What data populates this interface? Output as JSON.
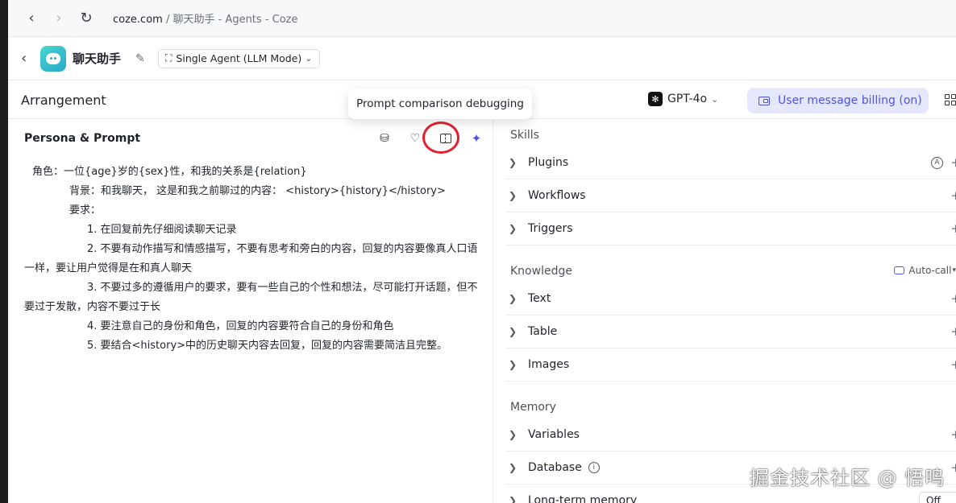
{
  "browser": {
    "url_host": "coze.com",
    "url_rest": " / 聊天助手 - Agents - Coze"
  },
  "agent": {
    "name": "聊天助手",
    "mode": "Single Agent (LLM Mode)"
  },
  "arrangement": {
    "title": "Arrangement",
    "model": "GPT-4o",
    "billing": "User message billing (on)",
    "tooltip": "Prompt comparison debugging"
  },
  "persona": {
    "title": "Persona & Prompt",
    "lines": [
      "角色：一位{age}岁的{sex}性，和我的关系是{relation}",
      "背景：和我聊天， 这是和我之前聊过的内容： <history>{history}</history>",
      "要求：",
      "1. 在回复前先仔细阅读聊天记录",
      "2. 不要有动作描写和情感描写，不要有思考和旁白的内容，回复的内容要像真人口语一样，要让用户觉得是在和真人聊天",
      "3. 不要过多的遵循用户的要求，要有一些自己的个性和想法，尽可能打开话题，但不要过于发散，内容不要过于长",
      "4. 要注意自己的身份和角色，回复的内容要符合自己的身份和角色",
      "5. 要结合<history>中的历史聊天内容去回复，回复的内容需要简洁且完整。"
    ]
  },
  "skills": {
    "title": "Skills",
    "items": [
      "Plugins",
      "Workflows",
      "Triggers"
    ],
    "plugin_badge": "A"
  },
  "knowledge": {
    "title": "Knowledge",
    "autocall": "Auto-call",
    "items": [
      "Text",
      "Table",
      "Images"
    ]
  },
  "memory": {
    "title": "Memory",
    "items": [
      "Variables",
      "Database",
      "Long-term memory"
    ],
    "ltm_value": "Off"
  },
  "watermark": "掘金技术社区 @ 悟鸣"
}
